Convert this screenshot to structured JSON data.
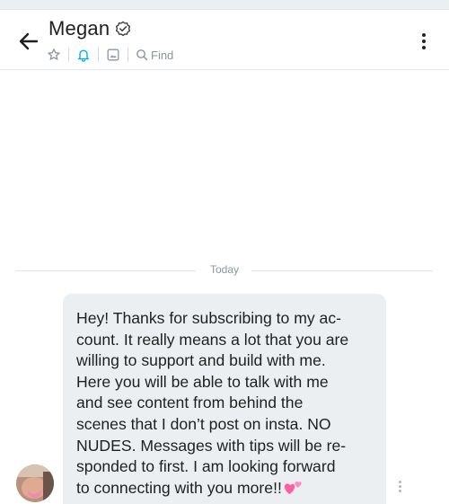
{
  "header": {
    "title": "Megan",
    "find_label": "Find",
    "icons": {
      "back": "arrow-left-icon",
      "verified": "verified-badge-icon",
      "favorite": "star-icon",
      "notifications": "bell-icon",
      "media": "image-icon",
      "search": "search-icon",
      "menu": "more-vertical-icon"
    }
  },
  "chat": {
    "date_divider": "Today",
    "messages": [
      {
        "sender": "Megan",
        "text": "Hey! Thanks for subscribing to my ac-\ncount. It really means a lot that you are\nwilling to support and build with me.\nHere you will be able to talk with me\nand see content from behind the\nscenes that I don’t post on insta. NO\nNUDES. Messages with tips will be re-\nsponded to first. I am looking forward\nto connecting with you more!!",
        "emoji": "two-hearts-icon"
      }
    ]
  },
  "colors": {
    "accent": "#00aff0",
    "bubble_bg": "#eceff1",
    "muted_text": "#8a96a0",
    "divider": "#dfe3e6"
  }
}
